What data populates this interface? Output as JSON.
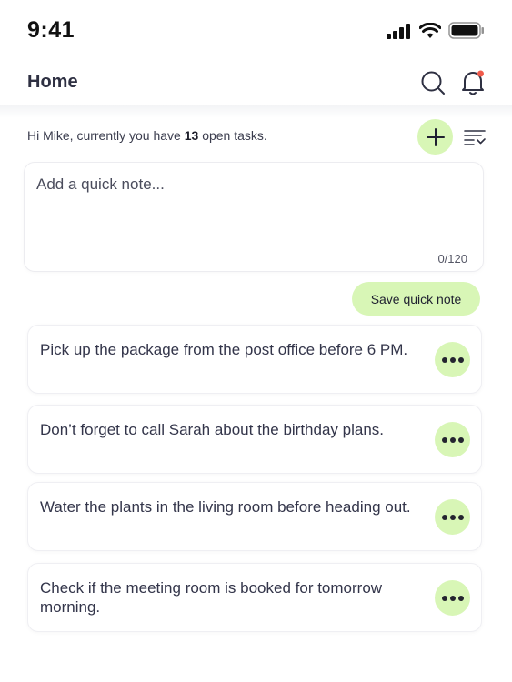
{
  "status_bar": {
    "time": "9:41"
  },
  "header": {
    "title": "Home"
  },
  "greeting": {
    "prefix": "Hi Mike, currently you have ",
    "count": "13",
    "suffix": " open tasks."
  },
  "quick_note": {
    "placeholder": "Add a quick note...",
    "value": "",
    "counter": "0/120",
    "save_label": "Save quick note"
  },
  "tasks": [
    {
      "text": "Pick up the package from the post office before 6 PM."
    },
    {
      "text": "Don’t forget to call Sarah about the birthday plans."
    },
    {
      "text": "Water the plants in the living room before heading out."
    },
    {
      "text": "Check if the meeting room is booked for tomorrow morning."
    }
  ],
  "icons": {
    "signal": "cellular-signal-icon",
    "wifi": "wifi-icon",
    "battery": "battery-icon",
    "search": "search-icon",
    "notifications": "bell-icon",
    "add": "plus-icon",
    "sort": "sort-filter-icon",
    "more": "more-dots-icon"
  },
  "colors": {
    "accent": "#d8f6b6",
    "notification_dot": "#f05a4b",
    "text_dark": "#2e3042"
  }
}
